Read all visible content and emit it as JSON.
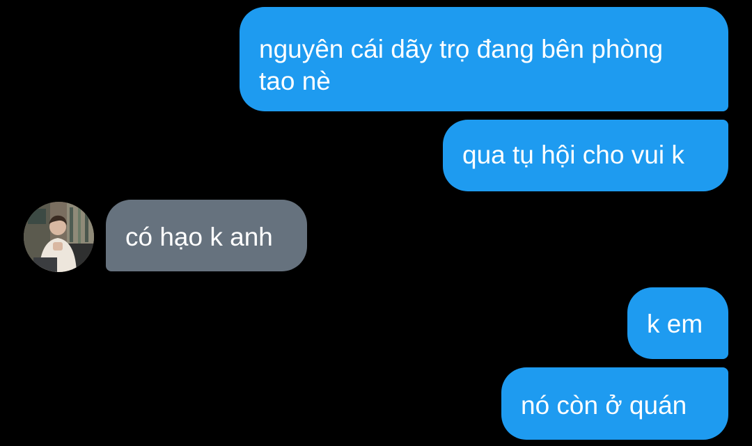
{
  "colors": {
    "background": "#000000",
    "outgoing_bubble": "#1e9bf0",
    "incoming_bubble": "#66727e",
    "text": "#ffffff"
  },
  "messages": [
    {
      "direction": "outgoing",
      "text_line1": "nguyên cái dãy trọ đang bên phòng",
      "text_line2": "tao nè"
    },
    {
      "direction": "outgoing",
      "text": "qua tụ hội cho vui k"
    },
    {
      "direction": "incoming",
      "text": "có hạo k anh",
      "avatar_icon": "user-avatar-photo"
    },
    {
      "direction": "outgoing",
      "text": "k em"
    },
    {
      "direction": "outgoing",
      "text": "nó còn ở quán"
    }
  ]
}
